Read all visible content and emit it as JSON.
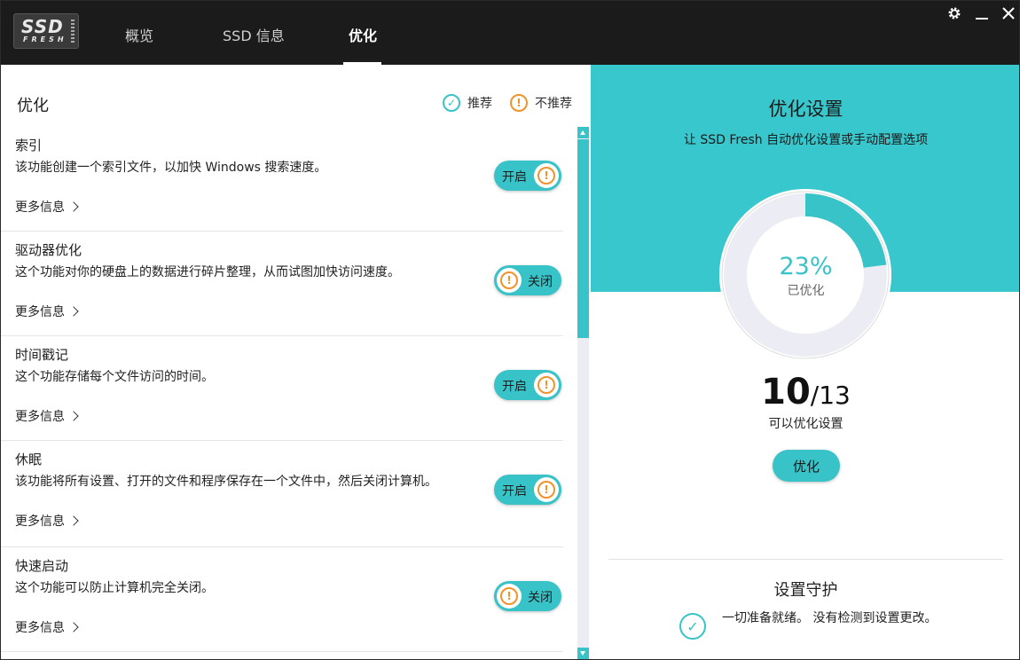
{
  "app": {
    "logo_line1": "SSD",
    "logo_line2": "FRESH",
    "tabs": [
      "概览",
      "SSD 信息",
      "优化"
    ],
    "active_tab": "优化",
    "window_controls": [
      "gear-icon",
      "minimize-icon",
      "close-icon"
    ]
  },
  "left": {
    "title": "优化",
    "legend": {
      "recommended": "推荐",
      "not_recommended": "不推荐"
    },
    "more_info_label": "更多信息",
    "items": [
      {
        "name": "索引",
        "desc": "该功能创建一个索引文件，以加快 Windows 搜索速度。",
        "toggle": "开启",
        "state": "on"
      },
      {
        "name": "驱动器优化",
        "desc": "这个功能对你的硬盘上的数据进行碎片整理，从而试图加快访问速度。",
        "toggle": "关闭",
        "state": "off"
      },
      {
        "name": "时间戳记",
        "desc": "这个功能存储每个文件访问的时间。",
        "toggle": "开启",
        "state": "on"
      },
      {
        "name": "休眠",
        "desc": "该功能将所有设置、打开的文件和程序保存在一个文件中，然后关闭计算机。",
        "toggle": "开启",
        "state": "on"
      },
      {
        "name": "快速启动",
        "desc": "这个功能可以防止计算机完全关闭。",
        "toggle": "关闭",
        "state": "off"
      }
    ]
  },
  "right": {
    "title": "优化设置",
    "subtitle": "让 SSD Fresh 自动优化设置或手动配置选项",
    "progress_fraction": 0.23,
    "percent_text": "23%",
    "percent_label": "已优化",
    "count_done": "10",
    "count_total": "/13",
    "count_label": "可以优化设置",
    "optimize_button": "优化",
    "guard_title": "设置守护",
    "guard_text": "一切准备就绪。 没有检测到设置更改。"
  },
  "colors": {
    "accent": "#38c3c8",
    "warning": "#f0932b",
    "titlebar": "#1b1b1c"
  }
}
